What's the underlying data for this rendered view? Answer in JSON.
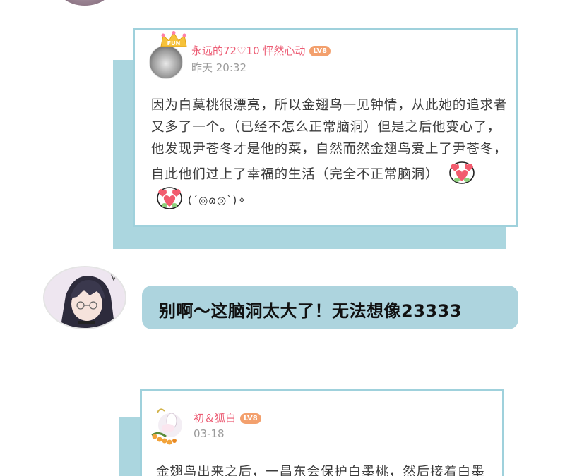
{
  "comment_1": {
    "username": "永远的72♡10 怦然心动",
    "level_badge": "LV8",
    "timestamp": "昨天 20:32",
    "body": "因为白莫桃很漂亮，所以金翅鸟一见钟情，从此她的追求者又多了一个。（已经不怎么正常脑洞）但是之后他变心了，他发现尹苍冬才是他的菜，自然而然金翅鸟爱上了尹苍冬，自此他们过上了幸福的生活（完全不正常脑洞）",
    "kaomoji": "(´◎ɷ◎`)✧",
    "stickers": [
      "heart-face-sticker",
      "heart-face-sticker"
    ],
    "crown_text": "FUN"
  },
  "chat": {
    "message": "别啊～这脑洞太大了！无法想像23333"
  },
  "comment_2": {
    "username": "初＆狐白",
    "level_badge": "LV8",
    "timestamp": "03-18",
    "body": "金翅鸟出来之后，一昌东会保护白墨桃，然后接着白墨"
  },
  "colors": {
    "card_border": "#9fd1dc",
    "card_shadow": "#abd6df",
    "username": "#ec5c74",
    "badge": "#f3a06d",
    "bubble": "#add4de"
  }
}
